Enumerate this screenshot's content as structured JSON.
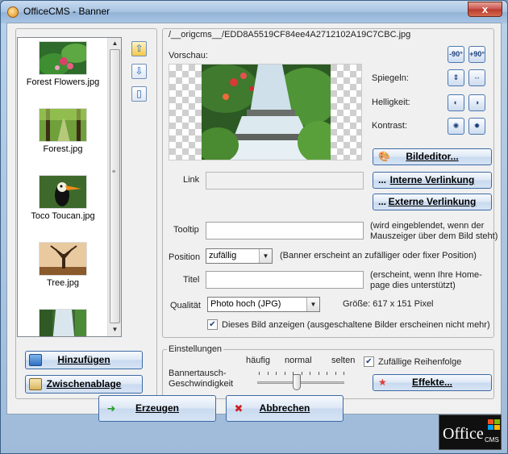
{
  "window": {
    "title": "OfficeCMS - Banner",
    "close_label": "x"
  },
  "images": [
    {
      "label": "Forest Flowers.jpg",
      "icon": "forest-flowers-thumbnail"
    },
    {
      "label": "Forest.jpg",
      "icon": "forest-thumbnail"
    },
    {
      "label": "Toco Toucan.jpg",
      "icon": "toucan-thumbnail"
    },
    {
      "label": "Tree.jpg",
      "icon": "tree-thumbnail"
    },
    {
      "label": "",
      "icon": "waterfall-thumbnail"
    }
  ],
  "left_buttons": {
    "add": "Hinzufügen",
    "clipboard": "Zwischenablage"
  },
  "detail": {
    "filepath": "/__origcms__/EDD8A5519CF84ee4A2712102A19C7CBC.jpg",
    "preview_label": "Vorschau:",
    "spiegeln": "Spiegeln:",
    "helligkeit": "Helligkeit:",
    "kontrast": "Kontrast:",
    "rotate_left": "-90°",
    "rotate_right": "+90°",
    "bildeditor": "Bildeditor...",
    "interne": "Interne Verlinkung",
    "externe": "Externe Verlinkung",
    "dots": "...",
    "link_label": "Link",
    "tooltip_label": "Tooltip",
    "tooltip_hint": "(wird eingeblendet, wenn der Mauszeiger über dem Bild steht)",
    "position_label": "Position",
    "position_value": "zufällig",
    "position_hint": "(Banner erscheint an zufälliger oder fixer Position)",
    "titel_label": "Titel",
    "titel_hint": "(erscheint, wenn Ihre Home-page dies unterstützt)",
    "qualitaet_label": "Qualität",
    "qualitaet_value": "Photo hoch (JPG)",
    "groesse": "Größe:   617 x 151 Pixel",
    "show_checkbox_label": "Dieses Bild anzeigen (ausgeschaltene Bilder erscheinen nicht mehr)",
    "show_checked": true
  },
  "settings": {
    "legend": "Einstellungen",
    "speed_label": "Bannertausch-Geschwindigkeit",
    "haeufig": "häufig",
    "normal": "normal",
    "selten": "selten",
    "random_label": "Zufällige Reihenfolge",
    "random_checked": true,
    "effekte": "Effekte...",
    "speed_value": 0.45
  },
  "bottom": {
    "create": "Erzeugen",
    "cancel": "Abbrechen"
  },
  "logo": {
    "text": "Office",
    "sub": "CMS"
  }
}
